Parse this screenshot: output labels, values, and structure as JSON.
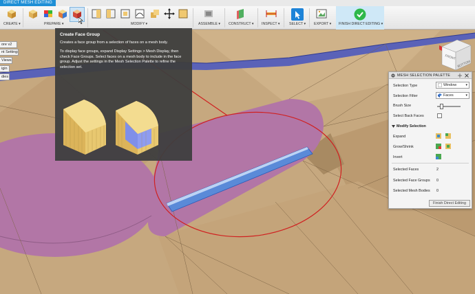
{
  "workspace_tab": "DIRECT MESH EDITING",
  "toolbar": {
    "groups": {
      "create": "CREATE ▾",
      "prepare": "PREPARE ▾",
      "modify": "MODIFY ▾",
      "assemble": "ASSEMBLE ▾",
      "construct": "CONSTRUCT ▾",
      "inspect": "INSPECT ▾",
      "select": "SELECT ▾",
      "export": "EXPORT ▾",
      "finish": "FINISH DIRECT EDITING ▾"
    }
  },
  "browser": {
    "items": [
      "ore v2",
      "nt Settings",
      "Views",
      "igin",
      "dies"
    ]
  },
  "tooltip": {
    "title": "Create Face Group",
    "para1": "Creates a face group from a selection of faces on a mesh body.",
    "para2": "To display face groups, expand Display Settings > Mesh Display, then check Face Groups. Select faces on a mesh body to include in the face group. Adjust the settings in the Mesh Selection Palette to refine the selection set."
  },
  "palette": {
    "title": "MESH SELECTION PALETTE",
    "selection_type_label": "Selection Type",
    "selection_type_value": "Window",
    "selection_filter_label": "Selection Filter",
    "selection_filter_value": "Faces",
    "brush_size_label": "Brush Size",
    "select_back_faces_label": "Select Back Faces",
    "modify_section": "Modify Selection",
    "expand_label": "Expand",
    "grow_shrink_label": "Grow/Shrink",
    "invert_label": "Invert",
    "selected_faces_label": "Selected Faces",
    "selected_faces_value": "2",
    "selected_face_groups_label": "Selected Face Groups",
    "selected_face_groups_value": "0",
    "selected_mesh_bodies_label": "Selected Mesh Bodies",
    "selected_mesh_bodies_value": "0",
    "finish_button": "Finish Direct Editing"
  },
  "viewcube": {
    "front": "FRONT",
    "bottom": "BOTTOM"
  },
  "colors": {
    "tab_blue": "#1e8fd6",
    "mesh_tan": "#c8aa82",
    "purple_body": "#b276a6",
    "selected_face": "#5a8ad8",
    "highlight_red": "#d02020"
  }
}
